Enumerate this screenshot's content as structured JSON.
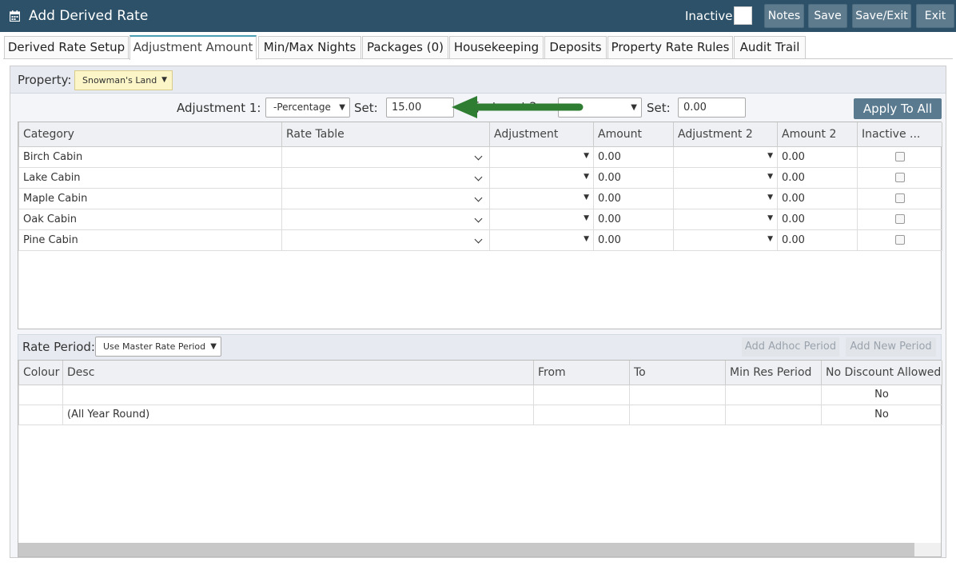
{
  "window": {
    "title": "Add Derived Rate",
    "inactive_label": "Inactive",
    "buttons": {
      "notes": "Notes",
      "save": "Save",
      "save_exit": "Save/Exit",
      "exit": "Exit"
    }
  },
  "tabs": [
    {
      "label": "Derived Rate Setup",
      "active": false
    },
    {
      "label": "Adjustment Amount",
      "active": true
    },
    {
      "label": "Min/Max Nights",
      "active": false
    },
    {
      "label": "Packages (0)",
      "active": false
    },
    {
      "label": "Housekeeping",
      "active": false
    },
    {
      "label": "Deposits",
      "active": false
    },
    {
      "label": "Property Rate Rules",
      "active": false
    },
    {
      "label": "Audit Trail",
      "active": false
    }
  ],
  "property": {
    "label": "Property:",
    "value": "Snowman's Land"
  },
  "adjustment": {
    "adj1_label": "Adjustment 1:",
    "adj1_value": "-Percentage",
    "set1_label": "Set:",
    "set1_value": "15.00",
    "adj2_label_partial": "ljustment 2:",
    "adj2_value": "",
    "set2_label": "Set:",
    "set2_value": "0.00",
    "apply_button": "Apply To All"
  },
  "category_table": {
    "columns": [
      "Category",
      "Rate Table",
      "Adjustment",
      "Amount",
      "Adjustment 2",
      "Amount 2",
      "Inactive ..."
    ],
    "rows": [
      {
        "category": "Birch Cabin",
        "rate_table": "",
        "adjustment": "",
        "amount": "0.00",
        "adjustment2": "",
        "amount2": "0.00",
        "inactive": false
      },
      {
        "category": "Lake Cabin",
        "rate_table": "",
        "adjustment": "",
        "amount": "0.00",
        "adjustment2": "",
        "amount2": "0.00",
        "inactive": false
      },
      {
        "category": "Maple Cabin",
        "rate_table": "",
        "adjustment": "",
        "amount": "0.00",
        "adjustment2": "",
        "amount2": "0.00",
        "inactive": false
      },
      {
        "category": "Oak Cabin",
        "rate_table": "",
        "adjustment": "",
        "amount": "0.00",
        "adjustment2": "",
        "amount2": "0.00",
        "inactive": false
      },
      {
        "category": "Pine Cabin",
        "rate_table": "",
        "adjustment": "",
        "amount": "0.00",
        "adjustment2": "",
        "amount2": "0.00",
        "inactive": false
      }
    ]
  },
  "rate_period": {
    "label": "Rate Period:",
    "value": "Use Master Rate Period",
    "add_adhoc": "Add Adhoc Period",
    "add_new": "Add New Period"
  },
  "period_table": {
    "columns": [
      "Colour",
      "Desc",
      "From",
      "To",
      "Min Res Period",
      "No Discount Allowed"
    ],
    "rows": [
      {
        "colour": "",
        "desc": "",
        "from": "",
        "to": "",
        "min_res": "",
        "no_discount": "No"
      },
      {
        "colour": "",
        "desc": "(All Year Round)",
        "from": "",
        "to": "",
        "min_res": "",
        "no_discount": "No"
      }
    ]
  },
  "colors": {
    "titlebar": "#2d5168",
    "button": "#5e7b8e",
    "active_tab_accent": "#4a9fb5",
    "property_select_bg": "#fbf5c7",
    "arrow": "#2e7d32"
  },
  "icons": {
    "title_icon": "calendar-icon",
    "annotation": "arrow-left-icon"
  }
}
